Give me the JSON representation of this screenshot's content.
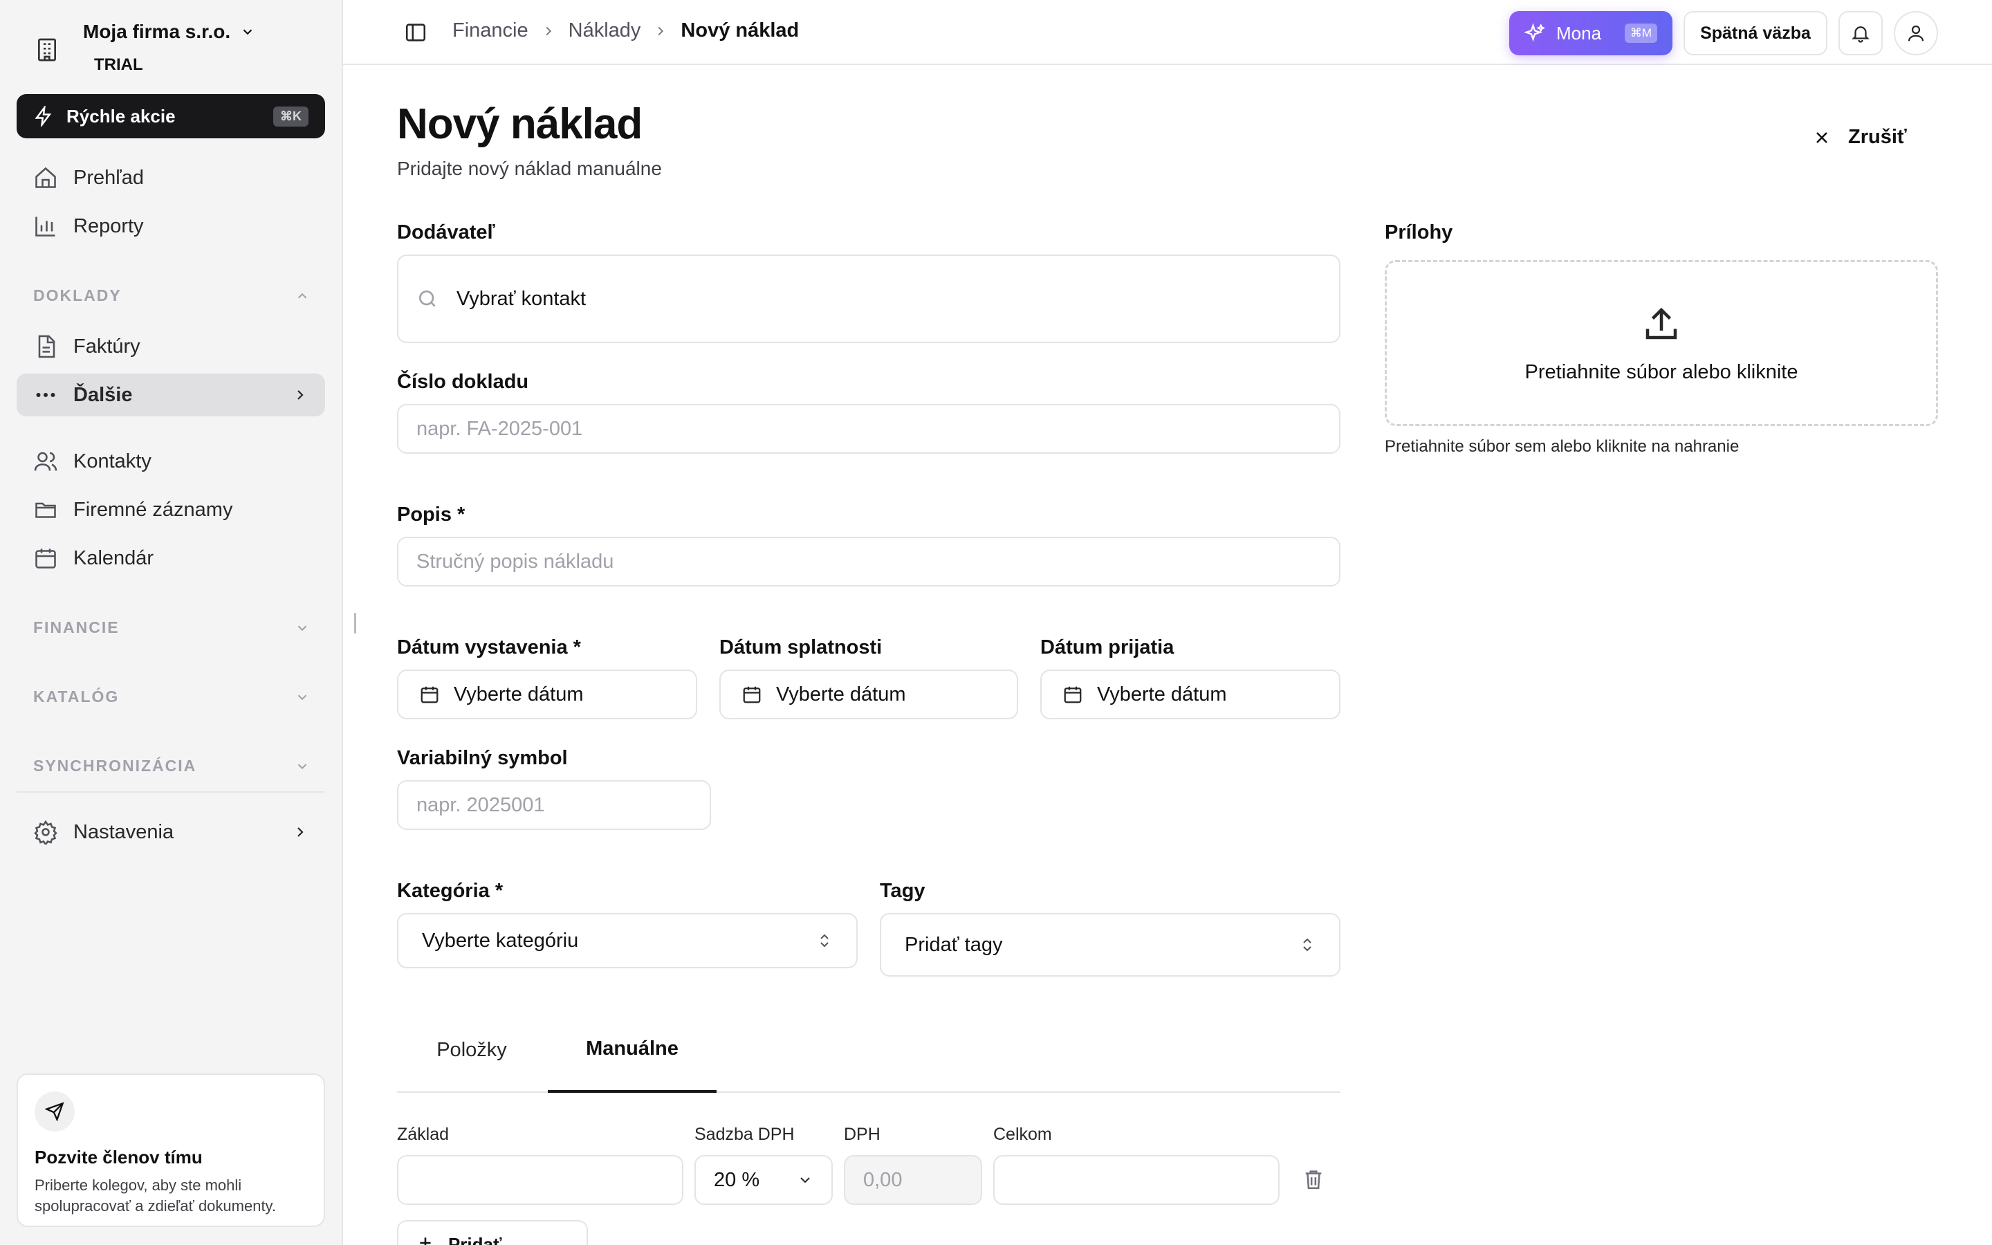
{
  "sidebar": {
    "company_name": "Moja firma s.r.o.",
    "company_plan": "TRIAL",
    "quick_actions": {
      "label": "Rýchle akcie",
      "shortcut": "⌘K"
    },
    "items_top": [
      {
        "label": "Prehľad",
        "icon": "home-icon"
      },
      {
        "label": "Reporty",
        "icon": "bar-chart-icon"
      }
    ],
    "section_doklady": "DOKLADY",
    "doklady_items": [
      {
        "label": "Faktúry",
        "icon": "document-icon"
      },
      {
        "label": "Ďalšie",
        "icon": "more-icon"
      }
    ],
    "contacts": [
      {
        "label": "Kontakty",
        "icon": "users-icon"
      },
      {
        "label": "Firemné záznamy",
        "icon": "folder-icon"
      },
      {
        "label": "Kalendár",
        "icon": "calendar-icon"
      }
    ],
    "section_financie": "FINANCIE",
    "section_katalog": "KATALÓG",
    "section_sync": "SYNCHRONIZÁCIA",
    "settings": "Nastavenia",
    "invite": {
      "title": "Pozvite členov tímu",
      "text": "Priberte kolegov, aby ste mohli spolupracovať a zdieľať dokumenty."
    }
  },
  "header": {
    "breadcrumbs": [
      "Financie",
      "Náklady",
      "Nový náklad"
    ],
    "mona_label": "Mona",
    "mona_shortcut": "⌘M",
    "feedback_label": "Spätná väzba"
  },
  "page": {
    "title": "Nový náklad",
    "subtitle": "Pridajte nový náklad manuálne",
    "cancel_label": "Zrušiť"
  },
  "form": {
    "supplier_label": "Dodávateľ",
    "supplier_placeholder": "Vybrať kontakt",
    "doc_number_label": "Číslo dokladu",
    "doc_number_placeholder": "napr. FA-2025-001",
    "description_label": "Popis *",
    "description_placeholder": "Stručný popis nákladu",
    "issue_date_label": "Dátum vystavenia *",
    "due_date_label": "Dátum splatnosti",
    "received_date_label": "Dátum prijatia",
    "date_placeholder": "Vyberte dátum",
    "variable_symbol_label": "Variabilný symbol",
    "variable_symbol_placeholder": "napr. 2025001",
    "category_label": "Kategória *",
    "category_value": "Vyberte kategóriu",
    "tags_label": "Tagy",
    "tags_value": "Pridať tagy"
  },
  "attachments": {
    "label": "Prílohy",
    "dropzone_text": "Pretiahnite súbor alebo kliknite",
    "hint": "Pretiahnite súbor sem alebo kliknite na nahranie"
  },
  "tabs": [
    "Položky",
    "Manuálne"
  ],
  "amounts": {
    "base_label": "Základ",
    "vat_rate_label": "Sadzba DPH",
    "vat_rate_value": "20 %",
    "vat_label": "DPH",
    "vat_value": "0,00",
    "total_label": "Celkom",
    "add_rate_label": "Pridať sadzbu"
  }
}
